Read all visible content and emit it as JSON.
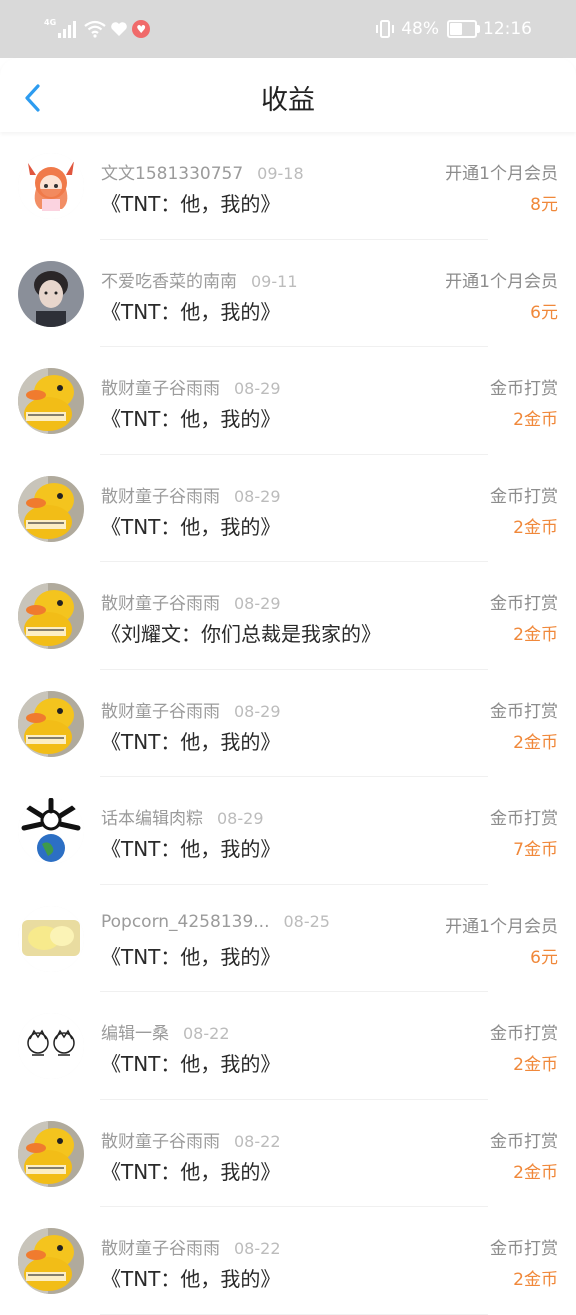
{
  "statusbar": {
    "network": "4G",
    "heart_badge": "♥",
    "battery_percent": "48%",
    "battery_level": 0.48,
    "time": "12:16"
  },
  "header": {
    "title": "收益"
  },
  "colors": {
    "accent_blue": "#2d9cf0",
    "amount_orange": "#f0883a"
  },
  "rows": [
    {
      "name": "文文1581330757",
      "date": "09-18",
      "title": "《TNT：他，我的》",
      "type": "开通1个月会员",
      "amount": "8元",
      "avatar": "anime-girl-avatar"
    },
    {
      "name": "不爱吃香菜的南南",
      "date": "09-11",
      "title": "《TNT：他，我的》",
      "type": "开通1个月会员",
      "amount": "6元",
      "avatar": "photo-avatar"
    },
    {
      "name": "散财童子谷雨雨",
      "date": "08-29",
      "title": "《TNT：他，我的》",
      "type": "金币打赏",
      "amount": "2金币",
      "avatar": "duck-avatar"
    },
    {
      "name": "散财童子谷雨雨",
      "date": "08-29",
      "title": "《TNT：他，我的》",
      "type": "金币打赏",
      "amount": "2金币",
      "avatar": "duck-avatar"
    },
    {
      "name": "散财童子谷雨雨",
      "date": "08-29",
      "title": "《刘耀文：你们总裁是我家的》",
      "type": "金币打赏",
      "amount": "2金币",
      "avatar": "duck-avatar"
    },
    {
      "name": "散财童子谷雨雨",
      "date": "08-29",
      "title": "《TNT：他，我的》",
      "type": "金币打赏",
      "amount": "2金币",
      "avatar": "duck-avatar"
    },
    {
      "name": "话本编辑肉粽",
      "date": "08-29",
      "title": "《TNT：他，我的》",
      "type": "金币打赏",
      "amount": "7金币",
      "avatar": "earth-avatar"
    },
    {
      "name": "Popcorn_4258139...",
      "date": "08-25",
      "title": "《TNT：他，我的》",
      "type": "开通1个月会员",
      "amount": "6元",
      "avatar": "popcorn-avatar"
    },
    {
      "name": "编辑一桑",
      "date": "08-22",
      "title": "《TNT：他，我的》",
      "type": "金币打赏",
      "amount": "2金币",
      "avatar": "sketch-avatar"
    },
    {
      "name": "散财童子谷雨雨",
      "date": "08-22",
      "title": "《TNT：他，我的》",
      "type": "金币打赏",
      "amount": "2金币",
      "avatar": "duck-avatar"
    },
    {
      "name": "散财童子谷雨雨",
      "date": "08-22",
      "title": "《TNT：他，我的》",
      "type": "金币打赏",
      "amount": "2金币",
      "avatar": "duck-avatar"
    }
  ]
}
